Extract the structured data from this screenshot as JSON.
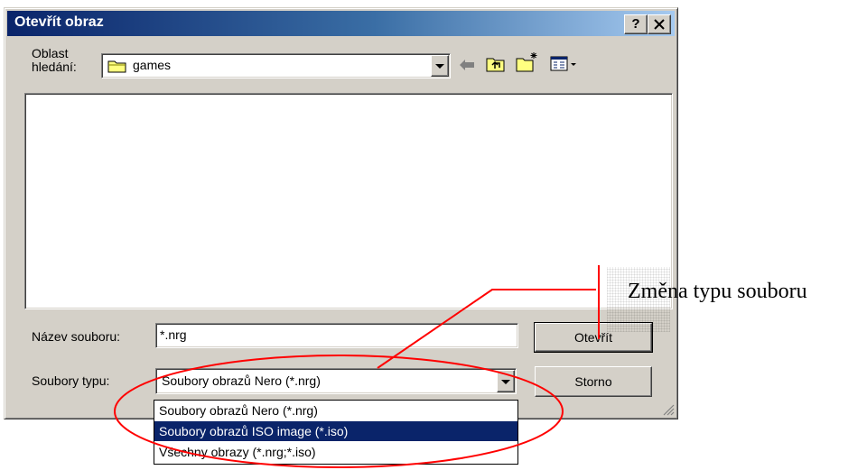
{
  "window": {
    "title": "Otevřít obraz",
    "help_label": "?",
    "close_label": "✕"
  },
  "lookin": {
    "label_line1": "Oblast",
    "label_line2": "hledání:",
    "value": "games",
    "icons": [
      "folder-icon",
      "back-arrow-icon",
      "up-folder-icon",
      "new-folder-icon",
      "view-menu-icon"
    ]
  },
  "filename": {
    "label": "Název souboru:",
    "value": "*.nrg"
  },
  "filetype": {
    "label": "Soubory typu:",
    "value": "Soubory obrazů Nero (*.nrg)",
    "options": [
      "Soubory obrazů Nero (*.nrg)",
      "Soubory obrazů ISO image (*.iso)",
      "Všechny obrazy (*.nrg;*.iso)"
    ],
    "highlighted_index": 1
  },
  "buttons": {
    "open": "Otevřít",
    "cancel": "Storno"
  },
  "annotation": {
    "text": "Změna typu souboru",
    "color": "#ff0000"
  },
  "colors": {
    "dialog_bg": "#d4d0c8",
    "titlebar": "#0a246a",
    "selection": "#0a246a"
  }
}
